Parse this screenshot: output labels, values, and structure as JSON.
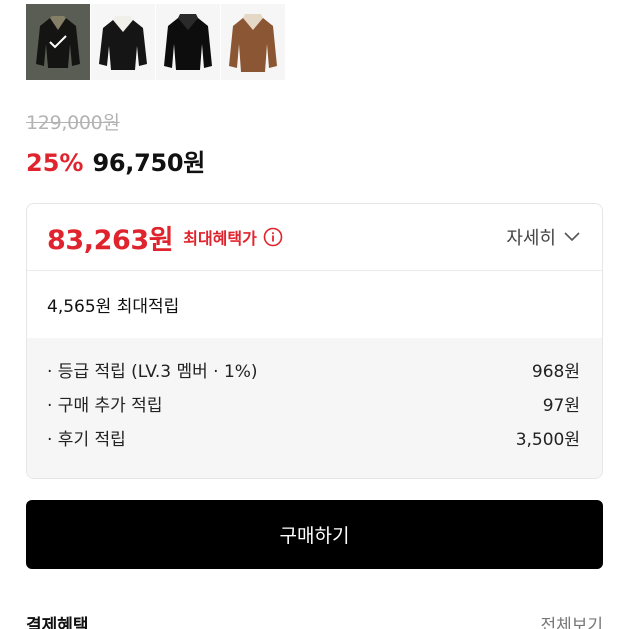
{
  "product": {
    "thumbnails": [
      {
        "icon": "jacket-olive-thumbnail",
        "selected": true
      },
      {
        "icon": "jacket-black-white-collar-thumbnail",
        "selected": false
      },
      {
        "icon": "jacket-black-thumbnail",
        "selected": false
      },
      {
        "icon": "jacket-brown-thumbnail",
        "selected": false
      }
    ]
  },
  "price": {
    "original": "129,000원",
    "discount_rate": "25%",
    "current": "96,750원"
  },
  "benefit": {
    "max_price": "83,263원",
    "max_label": "최대혜택가",
    "detail_label": "자세히",
    "max_points": "4,565원 최대적립",
    "items": [
      {
        "label": "· 등급 적립 (LV.3 멤버 · 1%)",
        "value": "968원"
      },
      {
        "label": "· 구매 추가 적립",
        "value": "97원"
      },
      {
        "label": "· 후기 적립",
        "value": "3,500원"
      }
    ]
  },
  "actions": {
    "buy_label": "구매하기"
  },
  "payment": {
    "title": "결제혜택",
    "view_all": "전체보기"
  },
  "colors": {
    "accent_red": "#e0242e",
    "button_black": "#000000"
  }
}
